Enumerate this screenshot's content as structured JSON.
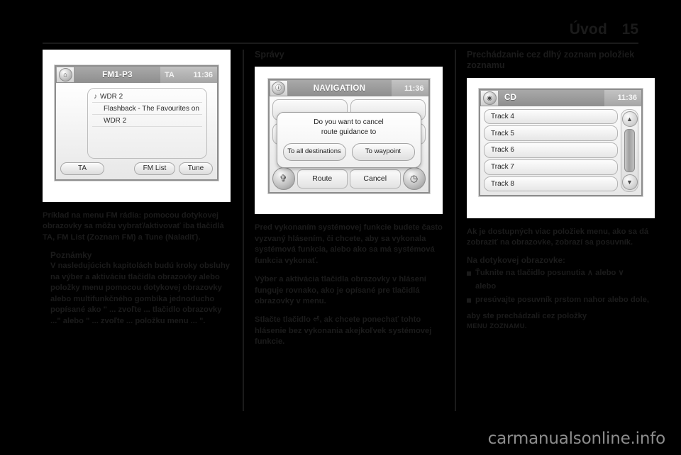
{
  "header": {
    "title": "Úvod",
    "page_number": "15"
  },
  "columns": [
    {
      "heading": "",
      "figure": {
        "type": "fm-radio-screen",
        "titlebar": {
          "home_icon": "home-icon",
          "label": "FM1-P3",
          "ta_indicator": "TA",
          "clock": "11:36"
        },
        "lines": [
          {
            "icon": "music-note-icon",
            "text": "WDR 2"
          },
          {
            "icon": "",
            "text": "Flashback - The Favourites on"
          },
          {
            "icon": "",
            "text": "WDR 2"
          }
        ],
        "buttons": {
          "ta": "TA",
          "fm_list": "FM List",
          "tune": "Tune"
        }
      },
      "paragraphs": [
        "Príklad na menu FM rádia: pomocou dotykovej obrazovky sa môžu vybrať/aktivovať iba tlačidlá TA, FM List (Zoznam FM) a Tune (Naladiť).",
        "V nasledujúcich kapitolách budú kroky obsluhy na výber a aktiváciu tlačidla obrazovky alebo položky menu pomocou dotykovej obrazovky alebo multifunkčného gombíka jednoducho popísané ako \" ... zvoľte ... tlačidlo obrazovky ...\" alebo \" ... zvoľte ... položku menu ... \"."
      ],
      "sub_heading": "Poznámky"
    },
    {
      "heading": "Správy",
      "figure": {
        "type": "navigation-screen",
        "titlebar": {
          "info_icon": "info-icon",
          "label": "NAVIGATION",
          "clock": "11:36"
        },
        "dialog": {
          "line1": "Do you want to cancel",
          "line2": "route guidance to",
          "button_left": "To all destinations",
          "button_right": "To waypoint"
        },
        "bottom_bar": {
          "left_icon": "compass-north-icon",
          "route_button": "Route",
          "cancel_button": "Cancel",
          "right_icon": "clock-icon"
        }
      },
      "paragraphs": [
        "Pred vykonaním systémovej funkcie budete často vyzvaný hlásením, či chcete, aby sa vykonala systémová funkcia, alebo ako sa má systémová funkcia vykonať.",
        "Výber a aktivácia tlačidla obrazovky v hlásení funguje rovnako, ako je opísané pre tlačidlá obrazovky v menu.",
        "Stlačte tlačidlo ⏎, ak chcete ponechať tohto hlásenie bez vykonania akejkoľvek systémovej funkcie."
      ]
    },
    {
      "heading": "Prechádzanie cez dlhý zoznam položiek zoznamu",
      "figure": {
        "type": "cd-list-screen",
        "titlebar": {
          "cd_icon": "cd-disc-icon",
          "label": "CD",
          "clock": "11:36"
        },
        "tracks": [
          "Track 4",
          "Track 5",
          "Track 6",
          "Track 7",
          "Track 8"
        ],
        "scrollbar": {
          "up_arrow": "chevron-up-icon",
          "down_arrow": "chevron-down-icon",
          "thumb": "scroll-thumb"
        }
      },
      "paragraphs": [
        "Ak je dostupných viac položiek menu, ako sa dá zobraziť na obrazovke, zobrazí sa posuvník."
      ],
      "sub_heading": "Na dotykovej obrazovke:",
      "bullets": [
        "Ťuknite na tlačidlo posunutia ∧ alebo ∨",
        "presúvajte posuvník prstom nahor alebo dole,"
      ],
      "or_text": "alebo",
      "closing_text": "aby ste prechádzali cez položky",
      "closing_smallcaps": "MENU ZOZNAMU."
    }
  ],
  "footer": {
    "watermark": "carmanualsonline.info"
  }
}
